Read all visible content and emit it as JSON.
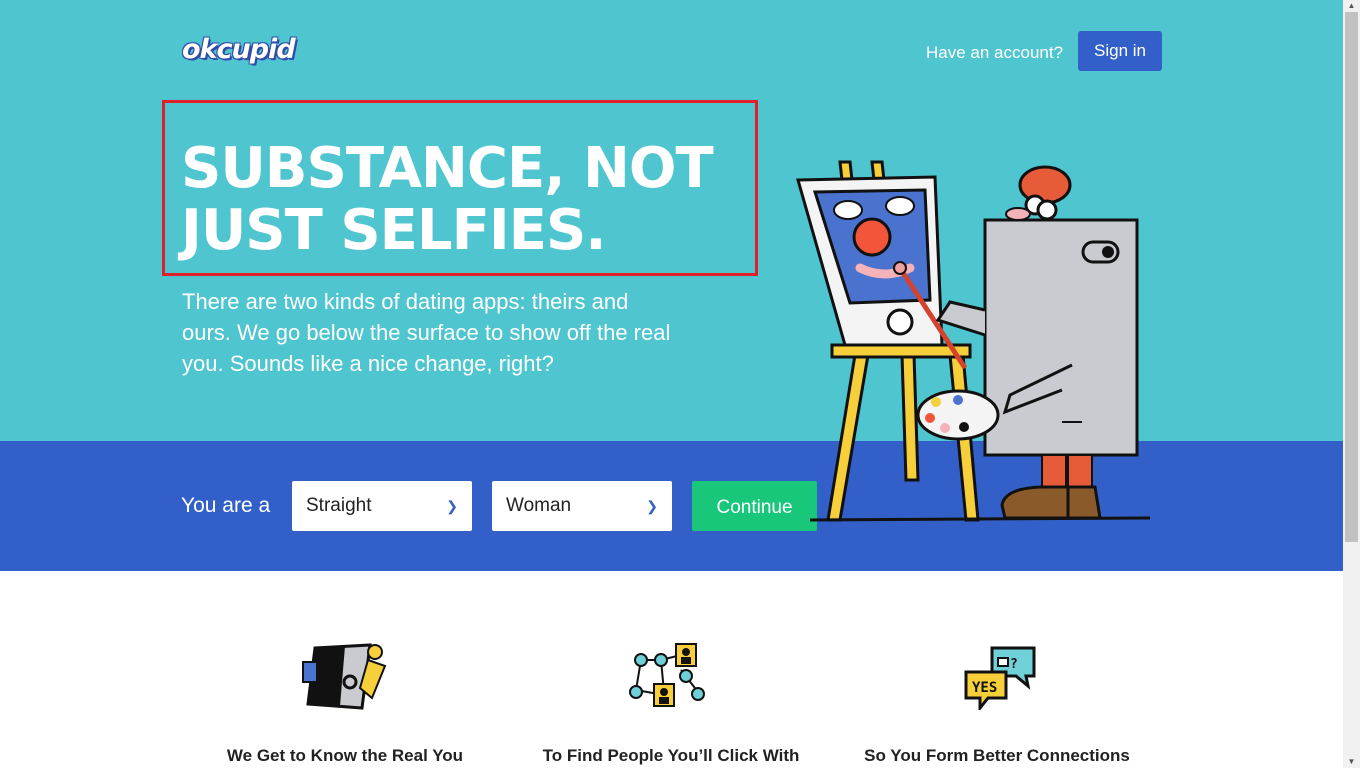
{
  "header": {
    "logo_text": "okcupid",
    "have_account": "Have an account?",
    "signin_label": "Sign in"
  },
  "hero": {
    "headline_line1": "SUBSTANCE, NOT",
    "headline_line2": "JUST SELFIES.",
    "subtext": "There are two kinds of dating apps: theirs and ours. We go below the surface to show off the real you. Sounds like a nice change, right?"
  },
  "form": {
    "you_are_label": "You are a",
    "orientation_value": "Straight",
    "gender_value": "Woman",
    "continue_label": "Continue"
  },
  "features": [
    {
      "title": "We Get to Know the Real You"
    },
    {
      "title": "To Find People You’ll Click With"
    },
    {
      "title": "So You Form Better Connections"
    }
  ],
  "colors": {
    "hero_bg": "#4ec5cf",
    "band_bg": "#3360c8",
    "continue_bg": "#18c77a",
    "highlight_border": "#e0202a"
  }
}
